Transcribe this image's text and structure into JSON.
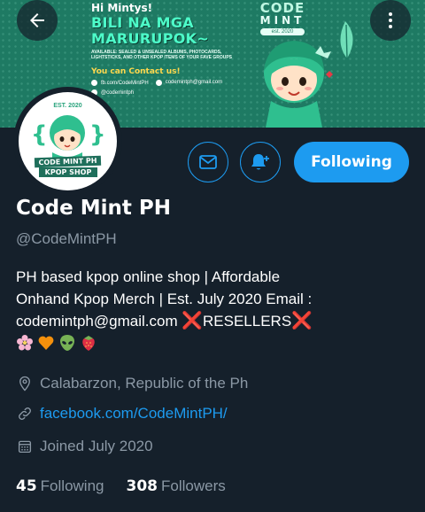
{
  "banner": {
    "greeting": "Hi Mintys!",
    "headline_1": "BILI NA MGA",
    "headline_2": "MARURUPOK~",
    "available_text": "Available: sealed & unsealed albums, photocards, lightsticks, and other kpop items of your fave groups",
    "contact_heading": "You can Contact us!",
    "contact_facebook": "fb.com/CodeMintPH",
    "contact_email": "codemintph@gmail.com",
    "contact_handle": "@codemintph",
    "logo_line_1": "CODE",
    "logo_line_2": "MINT",
    "logo_est": "est. 2020"
  },
  "header": {
    "back_icon": "arrow-left-icon",
    "more_icon": "more-vertical-icon"
  },
  "avatar": {
    "est_text": "EST. 2020",
    "name_line_1": "CODE MINT PH",
    "name_line_2": "KPOP SHOP"
  },
  "actions": {
    "message_icon": "envelope-icon",
    "notify_icon": "bell-plus-icon",
    "follow_label": "Following",
    "accent_color": "#1d9bf0"
  },
  "profile": {
    "name": "Code Mint PH",
    "handle": "@CodeMintPH",
    "bio_line_1": "PH based kpop online shop |  Affordable",
    "bio_line_2": "Onhand Kpop Merch | Est. July 2020   Email :",
    "bio_line_3_email": "codemintph@gmail.com",
    "bio_line_3_tag": "RESELLERS",
    "bio_x": "❌",
    "bio_emojis": [
      "cherry-blossom-icon",
      "orange-heart-icon",
      "alien-icon",
      "strawberry-icon"
    ],
    "location": "Calabarzon, Republic of the Ph",
    "website": "facebook.com/CodeMintPH/",
    "joined": "Joined July 2020",
    "following_count": "45",
    "following_label": "Following",
    "followers_count": "308",
    "followers_label": "Followers"
  },
  "colors": {
    "background": "#15202b",
    "muted": "#8b98a5",
    "banner_green": "#1e7a63",
    "reseller_red": "#f4212e"
  }
}
